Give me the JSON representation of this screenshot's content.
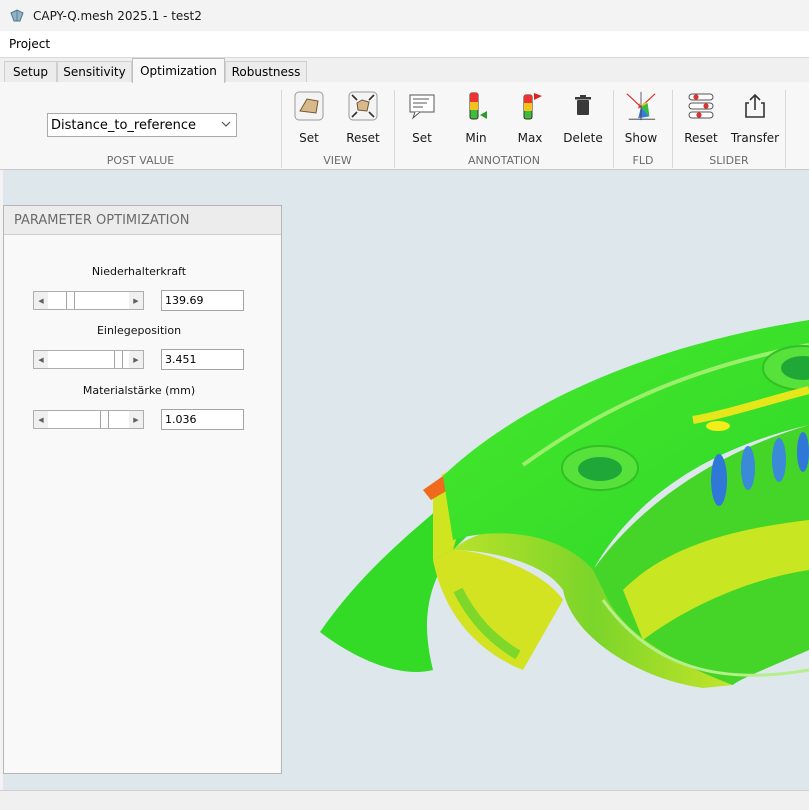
{
  "window": {
    "title": "CAPY-Q.mesh 2025.1 - test2"
  },
  "menu": {
    "project": "Project"
  },
  "tabs": {
    "setup": "Setup",
    "sensitivity": "Sensitivity",
    "optimization": "Optimization",
    "robustness": "Robustness",
    "active": "Optimization"
  },
  "ribbon": {
    "post_value": {
      "selected": "Distance_to_reference",
      "label": "POST VALUE"
    },
    "view": {
      "label": "VIEW",
      "set": "Set",
      "reset": "Reset"
    },
    "annotation": {
      "label": "ANNOTATION",
      "set": "Set",
      "min": "Min",
      "max": "Max",
      "delete": "Delete"
    },
    "fld": {
      "label": "FLD",
      "show": "Show"
    },
    "slider": {
      "label": "SLIDER",
      "reset": "Reset",
      "transfer": "Transfer"
    }
  },
  "panel": {
    "title": "PARAMETER OPTIMIZATION",
    "params": [
      {
        "label": "Niederhalterkraft",
        "value": "139.69",
        "slider_fraction": 0.25
      },
      {
        "label": "Einlegeposition",
        "value": "3.451",
        "slider_fraction": 0.92
      },
      {
        "label": "Materialstärke (mm)",
        "value": "1.036",
        "slider_fraction": 0.72
      }
    ]
  },
  "colors": {
    "workspace_bg": "#dde7ec",
    "mesh_green": "#3ee02a",
    "mesh_yellow": "#d8e81a",
    "mesh_red": "#e83a1e",
    "mesh_blue": "#3a7ad8"
  }
}
